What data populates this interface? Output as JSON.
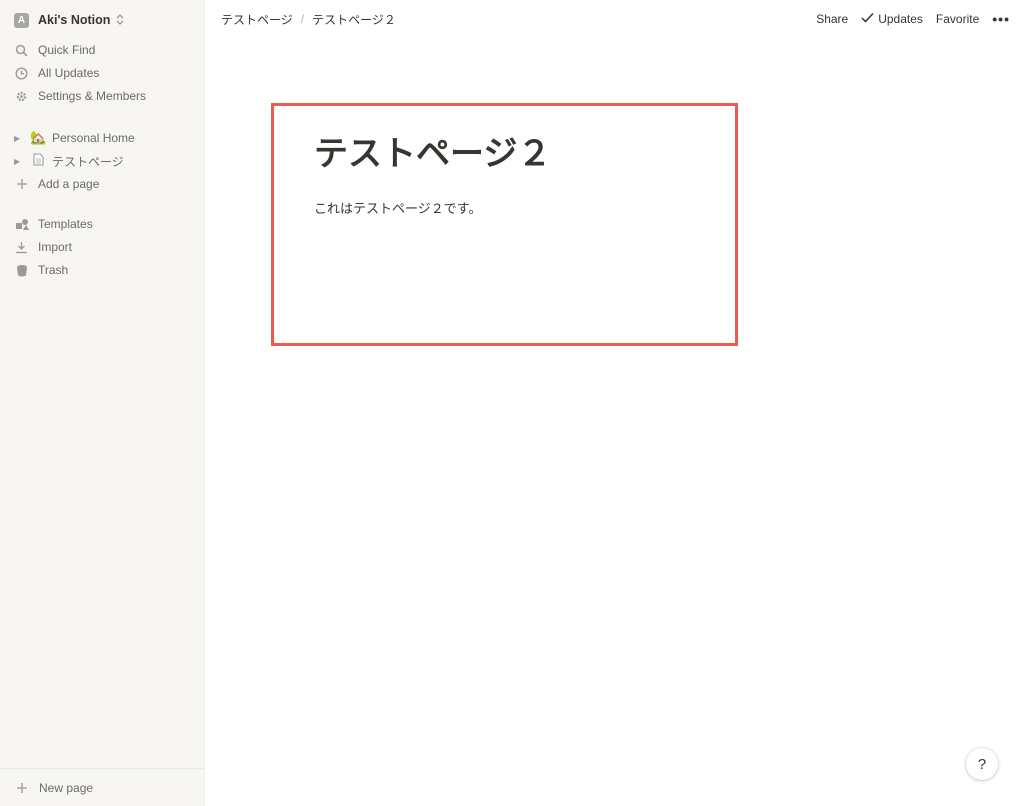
{
  "workspace": {
    "initial": "A",
    "name": "Aki's Notion"
  },
  "sidebar": {
    "top_items": [
      {
        "label": "Quick Find"
      },
      {
        "label": "All Updates"
      },
      {
        "label": "Settings & Members"
      }
    ],
    "pages": [
      {
        "emoji": "🏡",
        "label": "Personal Home"
      },
      {
        "label": "テストページ"
      }
    ],
    "add_page_label": "Add a page",
    "bottom_items": [
      {
        "label": "Templates"
      },
      {
        "label": "Import"
      },
      {
        "label": "Trash"
      }
    ],
    "new_page_label": "New page"
  },
  "topbar": {
    "breadcrumb": [
      "テストページ",
      "テストページ２"
    ],
    "separator": "/",
    "share_label": "Share",
    "updates_label": "Updates",
    "favorite_label": "Favorite",
    "more_label": "•••"
  },
  "page": {
    "title": "テストページ２",
    "body": "これはテストページ２です。"
  },
  "help_label": "?",
  "colors": {
    "sidebar_bg": "#f7f6f3",
    "text": "#37352f",
    "muted": "#6b6a66",
    "highlight": "#ee5a4f"
  }
}
